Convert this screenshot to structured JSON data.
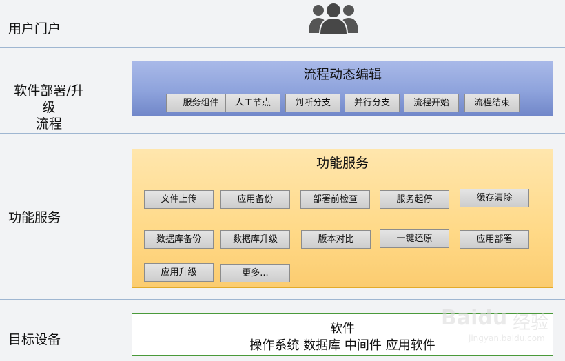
{
  "rows": {
    "portal": {
      "label": "用户门户"
    },
    "deploy": {
      "label_line1": "软件部署/升级",
      "label_line2": "流程"
    },
    "functions": {
      "label": "功能服务"
    },
    "target": {
      "label": "目标设备"
    }
  },
  "workflow_panel": {
    "title": "流程动态编辑",
    "items": [
      "服务组件",
      "人工节点",
      "判断分支",
      "并行分支",
      "流程开始",
      "流程结束"
    ]
  },
  "functions_panel": {
    "title": "功能服务",
    "items": [
      "文件上传",
      "应用备份",
      "部署前检查",
      "服务起停",
      "缓存清除",
      "数据库备份",
      "数据库升级",
      "版本对比",
      "一键还原",
      "应用部署",
      "应用升级",
      "更多..."
    ]
  },
  "target_panel": {
    "title": "软件",
    "subtitle": "操作系统  数据库  中间件  应用软件"
  },
  "watermark": {
    "brand": "Baidu",
    "text_cn": "经验",
    "url": "jingyan.baidu.com"
  },
  "colors": {
    "workflow_panel": "#8ea3dc",
    "functions_panel": "#ffd987",
    "target_border": "#4a9a3a",
    "user_icon": "#555555"
  },
  "icons": {
    "portal": "users-group-icon"
  }
}
